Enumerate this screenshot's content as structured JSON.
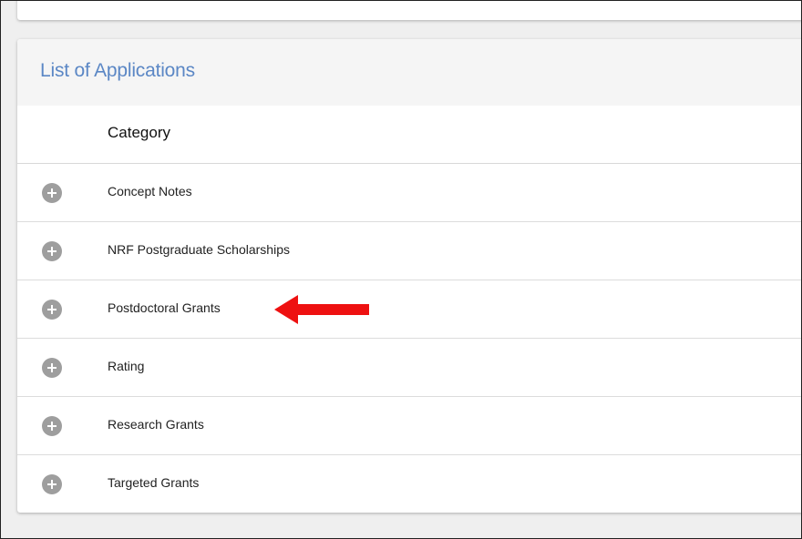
{
  "panel": {
    "title": "List of Applications",
    "column_header": "Category"
  },
  "categories": [
    {
      "label": "Concept Notes",
      "icon": "plus-circle-icon"
    },
    {
      "label": "NRF Postgraduate Scholarships",
      "icon": "plus-circle-icon"
    },
    {
      "label": "Postdoctoral Grants",
      "icon": "plus-circle-icon",
      "highlighted": true
    },
    {
      "label": "Rating",
      "icon": "plus-circle-icon"
    },
    {
      "label": "Research Grants",
      "icon": "plus-circle-icon"
    },
    {
      "label": "Targeted Grants",
      "icon": "plus-circle-icon"
    }
  ],
  "colors": {
    "title": "#5b87c5",
    "expand_button": "#9e9e9e",
    "annotation_arrow": "#ee1111"
  }
}
